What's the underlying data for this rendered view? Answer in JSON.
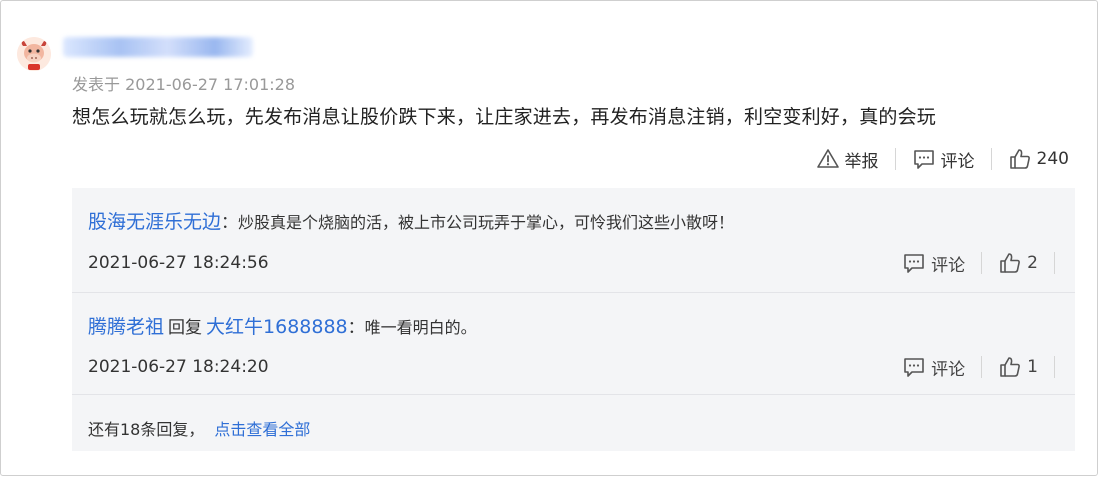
{
  "main_comment": {
    "avatar_icon": "cartoon-ox-avatar",
    "posted_label": "发表于",
    "timestamp": "2021-06-27 17:01:28",
    "text": "想怎么玩就怎么玩，先发布消息让股价跌下来，让庄家进去，再发布消息注销，利空变利好，真的会玩",
    "report_label": "举报",
    "comment_label": "评论",
    "like_count": "240"
  },
  "replies": [
    {
      "username": "股海无涯乐无边",
      "colon": "：",
      "text": "炒股真是个烧脑的活，被上市公司玩弄于掌心，可怜我们这些小散呀！",
      "timestamp": "2021-06-27 18:24:56",
      "comment_label": "评论",
      "like_count": "2"
    },
    {
      "username": "腾腾老祖",
      "reply_word": "回复",
      "reply_to": "大红牛1688888",
      "colon": "：",
      "text": "唯一看明白的。",
      "timestamp": "2021-06-27 18:24:20",
      "comment_label": "评论",
      "like_count": "1"
    }
  ],
  "more": {
    "count_text": "还有18条回复，",
    "link_text": "点击查看全部"
  },
  "colors": {
    "username_blue": "#2f6fd6",
    "panel_bg": "#f4f5f7",
    "meta_gray": "#999999"
  }
}
